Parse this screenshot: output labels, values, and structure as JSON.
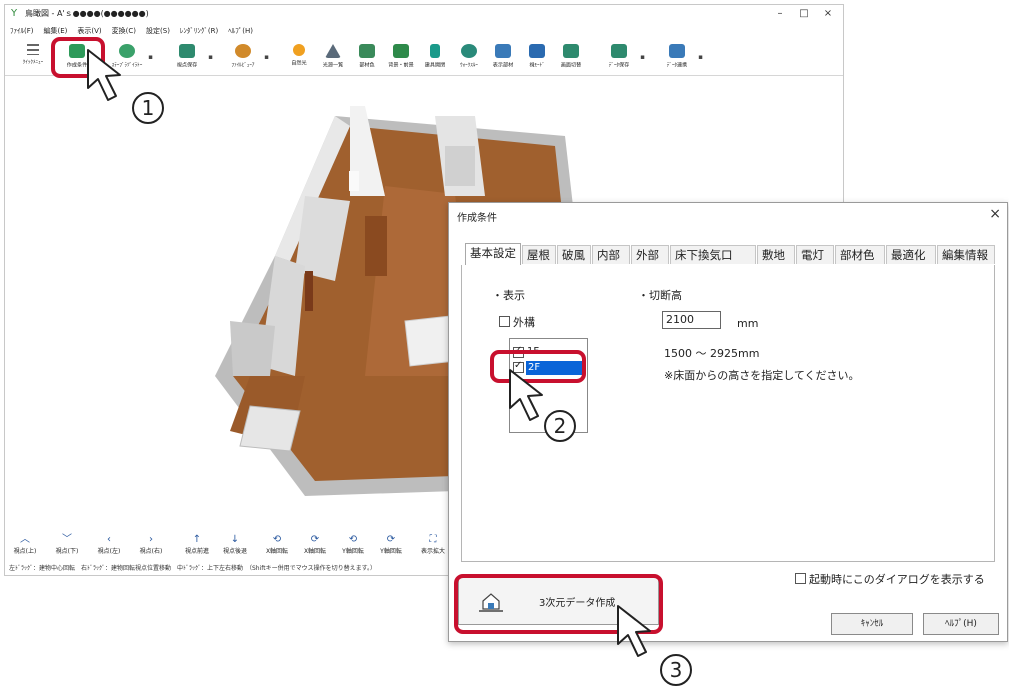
{
  "app": {
    "title": "鳥瞰図 - A'ｓ●●●●(●●●●●●)",
    "window_controls": {
      "minimize": "–",
      "maximize": "□",
      "close": "×"
    },
    "menu": [
      "ﾌｧｲﾙ(F)",
      "編集(E)",
      "表示(V)",
      "変換(C)",
      "設定(S)",
      "ﾚﾝﾀﾞﾘﾝｸﾞ(R)",
      "ﾍﾙﾌﾟ(H)"
    ],
    "toolbar": [
      {
        "label": "ｸｲｯｸﾒﾆｭｰ",
        "icon": "menu-icon",
        "color": "#666666"
      },
      {
        "label": "作成条件",
        "icon": "create-conditions-icon",
        "color": "#2e9a5a"
      },
      {
        "label": "ｽﾃｰﾌﾞﾗﾂﾞｲﾗﾄｰ",
        "icon": "stage-icon",
        "color": "#3aa16a"
      },
      {
        "label": "視点保存",
        "icon": "viewpoint-save-icon",
        "color": "#2e8a6e"
      },
      {
        "label": "ﾌｧｲﾙﾋﾞｭｰｱ",
        "icon": "file-viewer-icon",
        "color": "#d18a2a"
      },
      {
        "label": "自然光",
        "icon": "sunlight-icon",
        "color": "#f0a020"
      },
      {
        "label": "光源一覧",
        "icon": "light-list-icon",
        "color": "#5a6a7a"
      },
      {
        "label": "部材色",
        "icon": "material-color-icon",
        "color": "#3a8a5a"
      },
      {
        "label": "背景・前景",
        "icon": "background-icon",
        "color": "#2e8a4a"
      },
      {
        "label": "建具開閉",
        "icon": "door-icon",
        "color": "#1a9a8a"
      },
      {
        "label": "ｳｫｰｸｽﾙｰ",
        "icon": "walkthrough-icon",
        "color": "#2a8a7a"
      },
      {
        "label": "表示部材",
        "icon": "display-parts-icon",
        "color": "#3a7ab8"
      },
      {
        "label": "視ﾓｰﾄﾞ",
        "icon": "view-mode-icon",
        "color": "#2a6ab0"
      },
      {
        "label": "画面切替",
        "icon": "screen-switch-icon",
        "color": "#2e8a6e"
      },
      {
        "label": "ﾃﾞｰﾀ保存",
        "icon": "data-save-icon",
        "color": "#2e8a6e"
      },
      {
        "label": "ﾃﾞｰﾀ連携",
        "icon": "data-link-icon",
        "color": "#3a7ab8"
      }
    ],
    "nav_buttons": [
      {
        "label": "視点(上)",
        "arrow": "︿"
      },
      {
        "label": "視点(下)",
        "arrow": "﹀"
      },
      {
        "label": "視点(左)",
        "arrow": "‹"
      },
      {
        "label": "視点(右)",
        "arrow": "›"
      },
      {
        "label": "視点前進",
        "arrow": "↑"
      },
      {
        "label": "視点後退",
        "arrow": "↓"
      },
      {
        "label": "X軸回転",
        "arrow": "⟲"
      },
      {
        "label": "X軸回転",
        "arrow": "⟳"
      },
      {
        "label": "Y軸回転",
        "arrow": "⟲"
      },
      {
        "label": "Y軸回転",
        "arrow": "⟳"
      },
      {
        "label": "表示拡大",
        "arrow": "⛶"
      }
    ],
    "status": "左ﾄﾞﾗｯｸﾞ：建物中心回転　右ﾄﾞﾗｯｸﾞ：建物回転視点位置移動　中ﾄﾞﾗｯｸﾞ：上下左右移動　（Shiftキー併用でマウス操作を切り替えます。）"
  },
  "dialog": {
    "title": "作成条件",
    "close": "×",
    "tabs": [
      "基本設定",
      "屋根",
      "破風",
      "内部",
      "外部",
      "床下換気口",
      "敷地",
      "電灯",
      "部材色",
      "最適化",
      "編集情報"
    ],
    "active_tab": "基本設定",
    "display_section": {
      "header": "・表示",
      "exterior_label": "外構",
      "exterior_checked": false,
      "floors": [
        {
          "label": "1F",
          "checked": true
        },
        {
          "label": "2F",
          "checked": true
        }
      ]
    },
    "cut_section": {
      "header": "・切断高",
      "value": "2100",
      "unit": "mm",
      "range": "1500 ～ 2925mm",
      "note": "※床面からの高さを指定してください。"
    },
    "startup_label": "起動時にこのダイアログを表示する",
    "create_button": "3次元データ作成",
    "cancel_button": "ｷｬﾝｾﾙ",
    "help_button": "ﾍﾙﾌﾟ(H)"
  },
  "annotations": {
    "step1": "1",
    "step2": "2",
    "step3": "3",
    "highlight_color": "#c8102e"
  }
}
